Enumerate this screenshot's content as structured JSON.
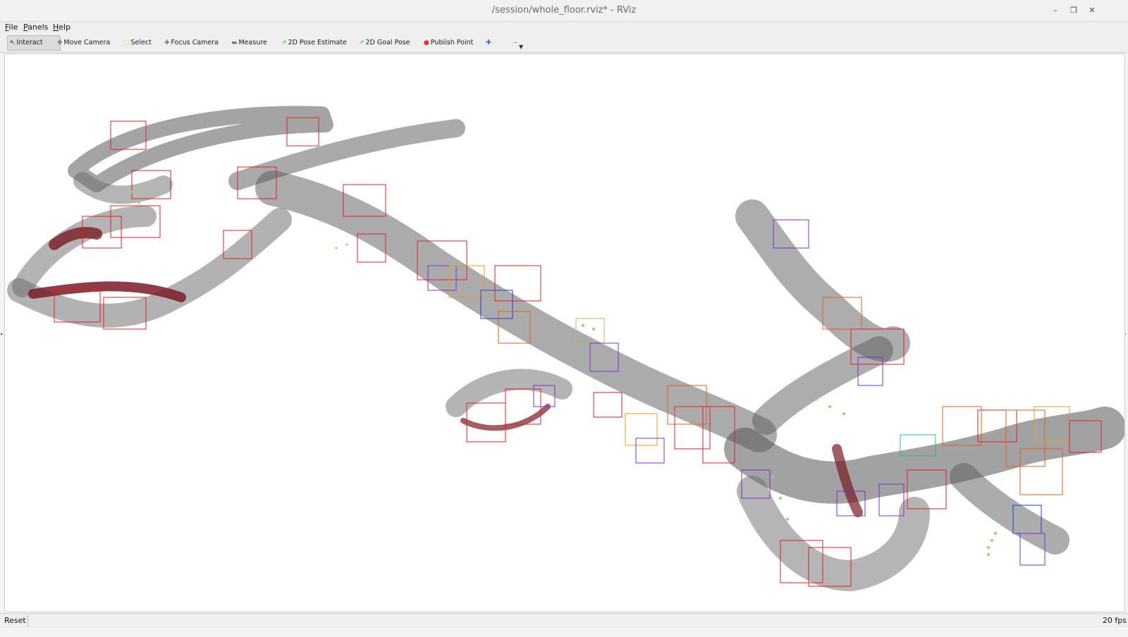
{
  "window": {
    "title": "/session/whole_floor.rviz* - RViz",
    "controls": [
      "minimize-icon",
      "restore-icon",
      "close-icon"
    ]
  },
  "menu": {
    "items": [
      {
        "label": "File",
        "accel": "F",
        "rest": "ile"
      },
      {
        "label": "Panels",
        "accel": "P",
        "rest": "anels"
      },
      {
        "label": "Help",
        "accel": "H",
        "rest": "elp"
      }
    ]
  },
  "toolbar": {
    "tools": [
      {
        "label": "Interact",
        "icon": "cursor-icon",
        "active": true
      },
      {
        "label": "Move Camera",
        "icon": "move-camera-icon"
      },
      {
        "label": "Select",
        "icon": "select-icon"
      },
      {
        "label": "Focus Camera",
        "icon": "focus-camera-icon"
      },
      {
        "label": "Measure",
        "icon": "measure-icon"
      },
      {
        "label": "2D Pose Estimate",
        "icon": "pose-estimate-arrow-icon"
      },
      {
        "label": "2D Goal Pose",
        "icon": "goal-pose-arrow-icon"
      },
      {
        "label": "Publish Point",
        "icon": "publish-point-pin-icon"
      }
    ],
    "extra_icons": [
      "add-tool-icon",
      "remove-tool-icon"
    ],
    "colors": {
      "pose": "#3dbb3d",
      "goal": "#3dbb3d",
      "publish": "#d33",
      "select": "#e0c020"
    }
  },
  "viewport": {
    "background": "#ffffff",
    "content": "3d-point-cloud-map"
  },
  "status": {
    "left": "Reset",
    "right": "20 fps"
  }
}
